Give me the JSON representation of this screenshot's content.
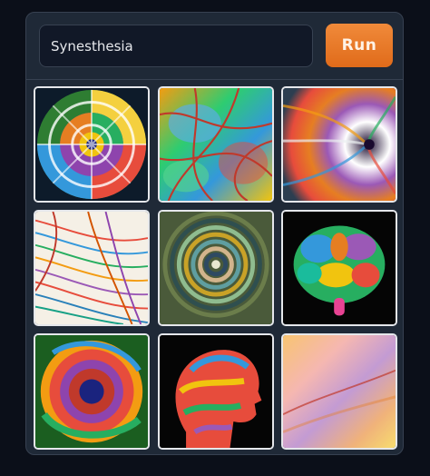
{
  "prompt": {
    "value": "Synesthesia"
  },
  "run_button": {
    "label": "Run"
  },
  "colors": {
    "accent": "#e8792a",
    "panel": "#1f2937",
    "background": "#0b0f19"
  },
  "gallery": {
    "images": [
      {
        "subject": "swirl-mosaic-icon"
      },
      {
        "subject": "web-lines-icon"
      },
      {
        "subject": "vortex-tunnel-icon"
      },
      {
        "subject": "flowing-lines-icon"
      },
      {
        "subject": "concentric-rings-icon"
      },
      {
        "subject": "neon-brain-icon"
      },
      {
        "subject": "spiral-ring-icon"
      },
      {
        "subject": "head-profile-icon"
      },
      {
        "subject": "gradient-wave-icon"
      }
    ]
  }
}
